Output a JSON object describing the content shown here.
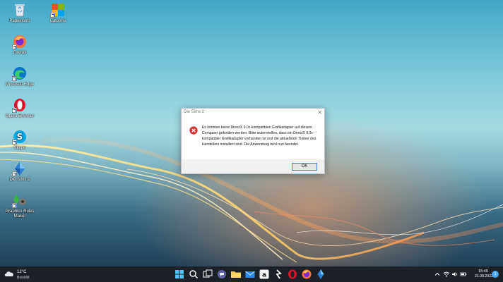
{
  "desktop": {
    "icons": [
      {
        "label": "Papierkorb"
      },
      {
        "label": "Bateone"
      },
      {
        "label": "Firefox"
      },
      {
        "label": "Microsoft Edge"
      },
      {
        "label": "Opera Browser"
      },
      {
        "label": "Skype"
      },
      {
        "label": "Die Sims 2"
      },
      {
        "label": "Graphics Rules Maker"
      }
    ]
  },
  "dialog": {
    "title": "Die Sims 2",
    "close": "✕",
    "message": "Es konnten keine DirectX 9.0c-kompatiblen Grafikadapter auf diesem Computer gefunden werden. Bitte sicherstellen, dass ein DirectX 9.0c-kompatibler Grafikadapter vorhanden ist und die aktuellsten Treiber des Herstellers installiert sind. Die Anwendung wird nun beendet.",
    "ok_label": "OK"
  },
  "taskbar": {
    "weather": {
      "temp": "12°C",
      "condition": "Bewölkt"
    },
    "apps": [
      "windows-start",
      "search",
      "task-view",
      "teams-chat",
      "file-explorer",
      "mail",
      "amazon",
      "capcut",
      "opera",
      "firefox",
      "sims"
    ],
    "tray": {
      "time": "15:40",
      "date": "21.09.2022",
      "notifications": "1"
    }
  },
  "colors": {
    "taskbar": "#1c2128",
    "dialog_footer": "#f0f0f0",
    "error_red": "#d32f2f",
    "ok_border": "#3c7fd7"
  }
}
